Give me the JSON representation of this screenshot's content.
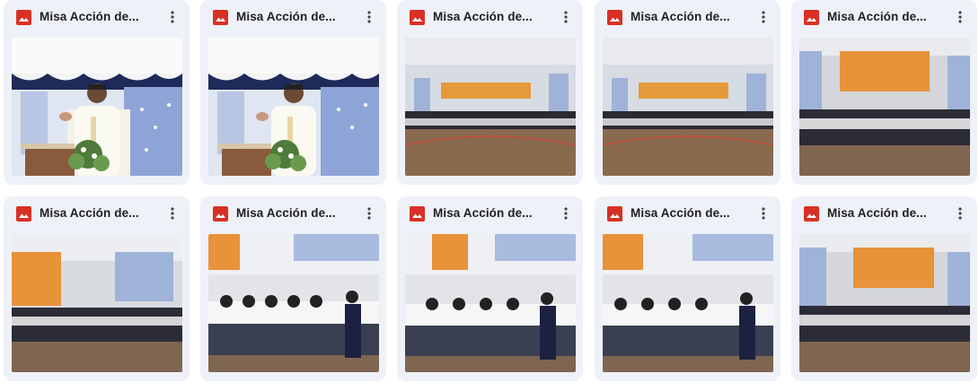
{
  "files": [
    {
      "name": "Misa Acción de...",
      "scene": "priest"
    },
    {
      "name": "Misa Acción de...",
      "scene": "priest"
    },
    {
      "name": "Misa Acción de...",
      "scene": "gym-wide"
    },
    {
      "name": "Misa Acción de...",
      "scene": "gym-wide"
    },
    {
      "name": "Misa Acción de...",
      "scene": "gym-rows"
    },
    {
      "name": "Misa Acción de...",
      "scene": "gym-side"
    },
    {
      "name": "Misa Acción de...",
      "scene": "students-close"
    },
    {
      "name": "Misa Acción de...",
      "scene": "students-close"
    },
    {
      "name": "Misa Acción de...",
      "scene": "students-close"
    },
    {
      "name": "Misa Acción de...",
      "scene": "gym-rows"
    }
  ],
  "icons": {
    "file_type": "image-icon",
    "menu": "more-vert-icon"
  },
  "colors": {
    "image_icon": "#d93025",
    "card_bg": "#eef1f7"
  }
}
